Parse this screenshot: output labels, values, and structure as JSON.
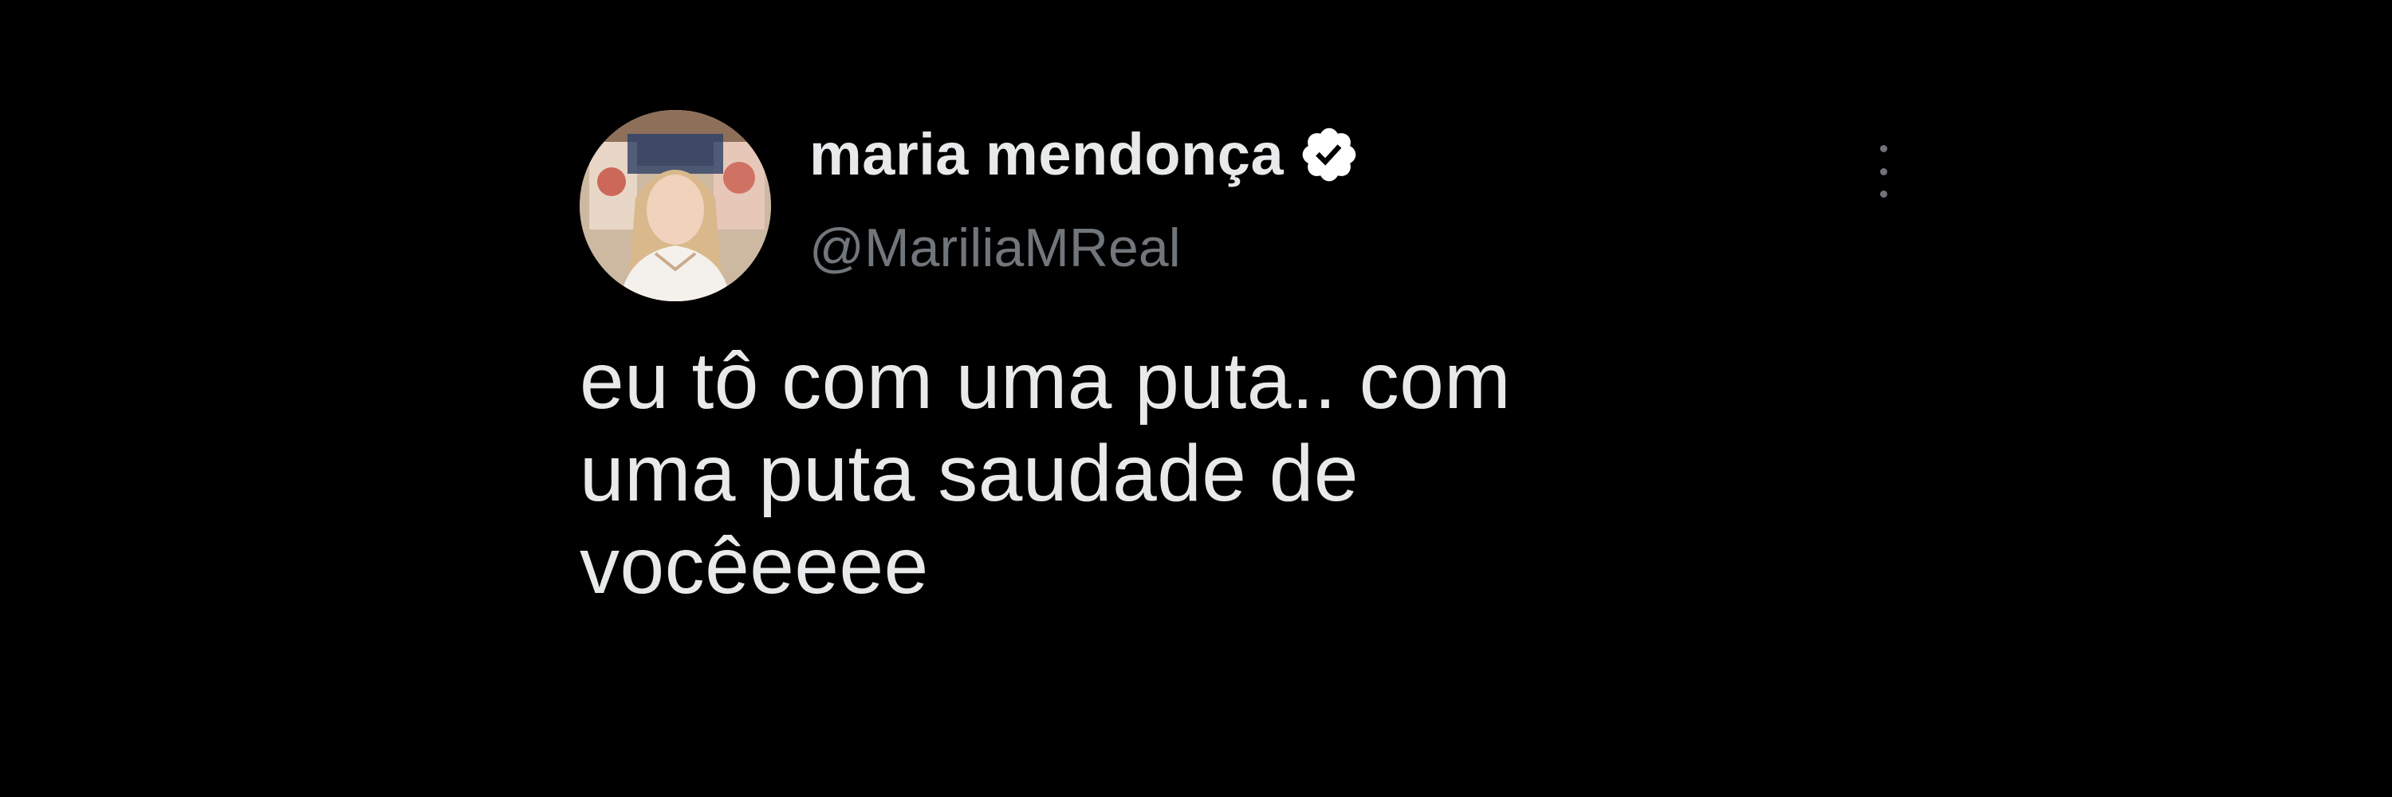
{
  "tweet": {
    "author": {
      "display_name": "maria mendonça",
      "handle": "@MariliaMReal",
      "verified": true,
      "avatar_icon": "profile-photo"
    },
    "text": "eu tô com uma puta..  com\numa puta saudade de\nvocêeeee",
    "menu_icon": "more-options-icon"
  },
  "colors": {
    "background": "#000000",
    "text_primary": "#e7e9ea",
    "text_secondary": "#71767b",
    "verified_badge": "#ffffff"
  }
}
